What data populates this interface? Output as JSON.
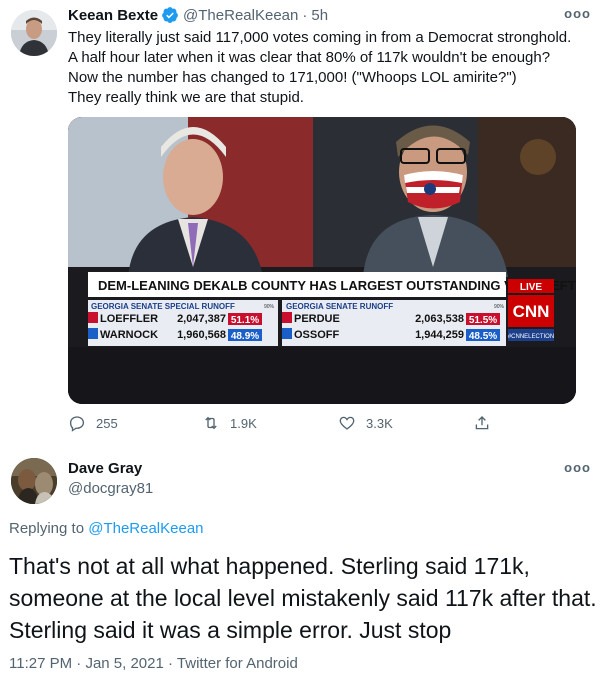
{
  "tweet": {
    "author_name": "Keean Bexte",
    "author_handle": "@TheRealKeean",
    "time": "5h",
    "text_lines": [
      "They literally just said 117,000 votes coming in from a Democrat stronghold.",
      "A half hour later when it was clear that 80% of 117k wouldn't be enough?",
      "Now the number has changed to 171,000! (\"Whoops LOL amirite?\")",
      "They really think we are that stupid."
    ],
    "media": {
      "banner": "DEM-LEANING DEKALB COUNTY HAS LARGEST OUTSTANDING VOTE LEFT",
      "live_label": "LIVE",
      "network": "CNN",
      "hashtag": "#CNNELECTION",
      "left_race": {
        "title": "GEORGIA SENATE SPECIAL RUNOFF",
        "rows": [
          {
            "name": "LOEFFLER",
            "votes": "2,047,387",
            "pct": "51.1%"
          },
          {
            "name": "WARNOCK",
            "votes": "1,960,568",
            "pct": "48.9%"
          }
        ]
      },
      "right_race": {
        "title": "GEORGIA SENATE RUNOFF",
        "rows": [
          {
            "name": "PERDUE",
            "votes": "2,063,538",
            "pct": "51.5%"
          },
          {
            "name": "OSSOFF",
            "votes": "1,944,259",
            "pct": "48.5%"
          }
        ]
      },
      "in_label": "90%"
    },
    "stats": {
      "replies": "255",
      "retweets": "1.9K",
      "likes": "3.3K"
    }
  },
  "reply": {
    "author_name": "Dave Gray",
    "author_handle": "@docgray81",
    "replying_prefix": "Replying to ",
    "replying_to": "@TheRealKeean",
    "text": "That's not at all what happened. Sterling said 171k, someone at the local level mistakenly said 117k after that. Sterling said it was a simple error. Just stop",
    "time": "11:27 PM",
    "date": "Jan 5, 2021",
    "source": "Twitter for Android",
    "separator": " · "
  },
  "colors": {
    "accent": "#1d9bf0",
    "secondary_text": "#536471",
    "cnn_red": "#cc0000"
  }
}
